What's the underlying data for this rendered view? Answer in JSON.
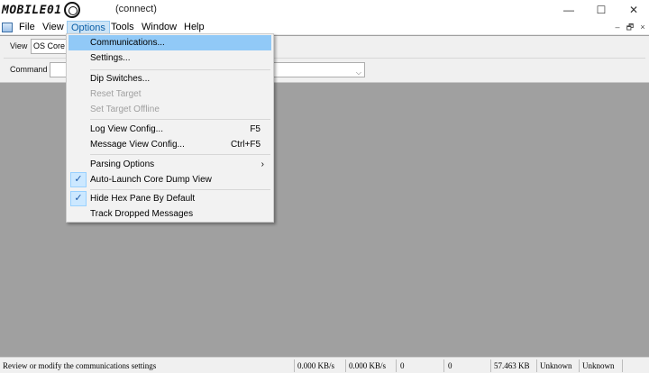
{
  "titlebar": {
    "logo_text": "MOBILE01",
    "title": "(connect)",
    "minimize_glyph": "—",
    "maximize_glyph": "☐",
    "close_glyph": "✕"
  },
  "menubar": {
    "items": [
      "File",
      "View",
      "Options",
      "Tools",
      "Window",
      "Help"
    ],
    "active": "Options",
    "mdi_min": "–",
    "mdi_restore": "🗗",
    "mdi_close": "×"
  },
  "toolbar": {
    "view_label": "View",
    "view_value": "OS Core D",
    "command_label": "Command",
    "command_value": "",
    "combo_arrow": "⌵"
  },
  "options_menu": {
    "items": [
      {
        "label": "Communications...",
        "shortcut": "",
        "highlighted": true,
        "disabled": false,
        "checked": false,
        "submenu": false
      },
      {
        "label": "Settings...",
        "shortcut": "",
        "highlighted": false,
        "disabled": false,
        "checked": false,
        "submenu": false
      },
      {
        "label": "Dip Switches...",
        "shortcut": "",
        "highlighted": false,
        "disabled": false,
        "checked": false,
        "submenu": false
      },
      {
        "label": "Reset Target",
        "shortcut": "",
        "highlighted": false,
        "disabled": true,
        "checked": false,
        "submenu": false
      },
      {
        "label": "Set Target Offline",
        "shortcut": "",
        "highlighted": false,
        "disabled": true,
        "checked": false,
        "submenu": false
      },
      {
        "label": "Log View Config...",
        "shortcut": "F5",
        "highlighted": false,
        "disabled": false,
        "checked": false,
        "submenu": false
      },
      {
        "label": "Message View Config...",
        "shortcut": "Ctrl+F5",
        "highlighted": false,
        "disabled": false,
        "checked": false,
        "submenu": false
      },
      {
        "label": "Parsing Options",
        "shortcut": "",
        "highlighted": false,
        "disabled": false,
        "checked": false,
        "submenu": true
      },
      {
        "label": "Auto-Launch Core Dump View",
        "shortcut": "",
        "highlighted": false,
        "disabled": false,
        "checked": true,
        "submenu": false
      },
      {
        "label": "Hide Hex Pane By Default",
        "shortcut": "",
        "highlighted": false,
        "disabled": false,
        "checked": true,
        "submenu": false
      },
      {
        "label": "Track Dropped Messages",
        "shortcut": "",
        "highlighted": false,
        "disabled": false,
        "checked": false,
        "submenu": false
      }
    ],
    "check_glyph": "✓",
    "submenu_glyph": "›"
  },
  "statusbar": {
    "message": "Review or modify the communications settings",
    "rate_in": "0.000 KB/s",
    "rate_out": "0.000 KB/s",
    "count_a": "0",
    "count_b": "0",
    "size": "57.463 KB",
    "field_a": "Unknown",
    "field_b": "Unknown"
  },
  "colors": {
    "workspace": "#a0a0a0",
    "menu_highlight": "#91c9f7",
    "active_menu_text": "#0b5fa8"
  }
}
